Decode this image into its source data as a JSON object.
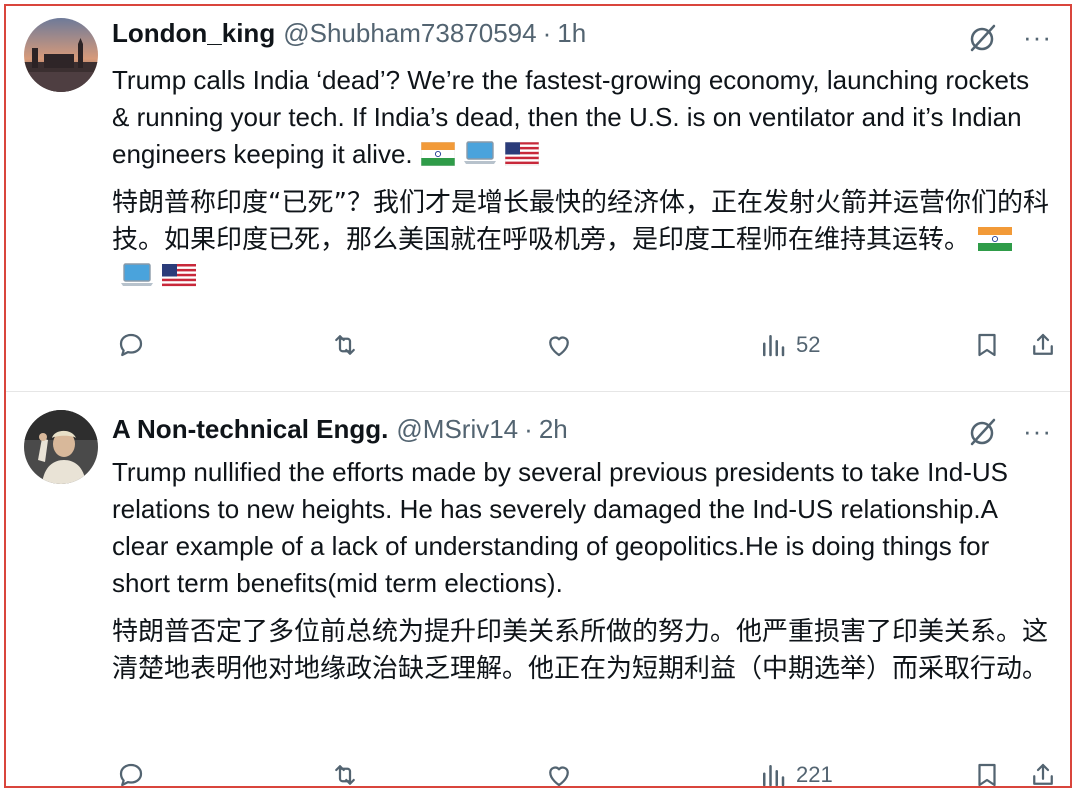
{
  "tweets": [
    {
      "display_name": "London_king",
      "handle": "@Shubham73870594",
      "separator": "·",
      "time": "1h",
      "text_en": "Trump calls India ‘dead’? We’re the fastest-growing economy, launching rockets & running your tech. If India’s dead, then the U.S. is on ventilator and it’s Indian engineers keeping it alive.",
      "text_zh": "特朗普称印度“已死”？我们才是增长最快的经济体，正在发射火箭并运营你们的科技。如果印度已死，那么美国就在呼吸机旁，是印度工程师在维持其运转。",
      "emoji_en": [
        "flag-india",
        "laptop",
        "flag-us"
      ],
      "emoji_zh": [
        "flag-india",
        "laptop",
        "flag-us"
      ],
      "views": "52"
    },
    {
      "display_name": "A Non-technical Engg.",
      "handle": "@MSriv14",
      "separator": "·",
      "time": "2h",
      "text_en": "Trump nullified the efforts made by several previous presidents to take Ind-US relations to new heights. He has severely damaged the Ind-US relationship.A clear example of a lack of understanding of geopolitics.He is doing things for short term benefits(mid term elections).",
      "text_zh": "特朗普否定了多位前总统为提升印美关系所做的努力。他严重损害了印美关系。这清楚地表明他对地缘政治缺乏理解。他正在为短期利益（中期选举）而采取行动。",
      "views": "221"
    }
  ],
  "more_label": "···",
  "colors": {
    "frame_border": "#d9453c",
    "text": "#0f1419",
    "muted": "#536471"
  }
}
